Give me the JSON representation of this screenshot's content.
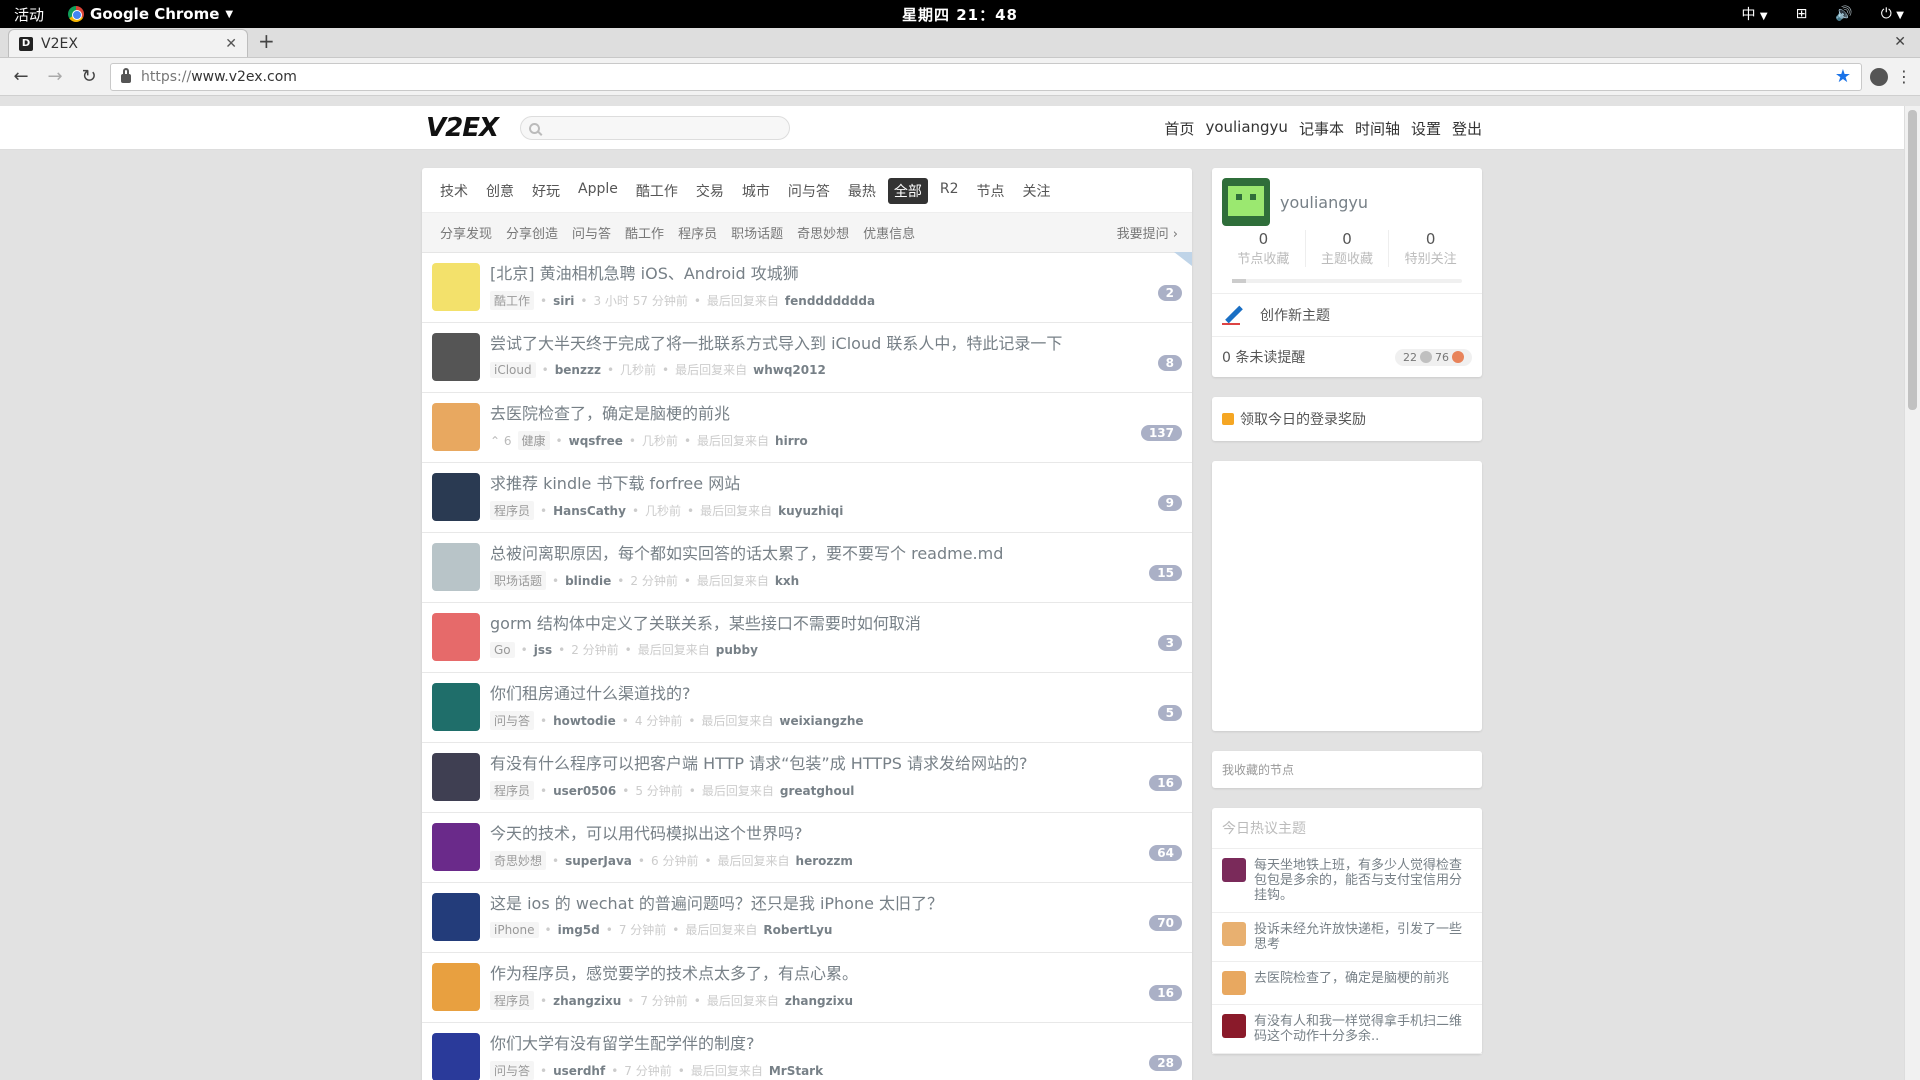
{
  "gnome": {
    "activities": "活动",
    "app": "Google Chrome",
    "clock": "星期四 21：48",
    "ime": "中"
  },
  "browser": {
    "tab_title": "V2EX",
    "url_scheme": "https://",
    "url_host": "www.v2ex.com"
  },
  "site": {
    "logo": "V2EX",
    "search_placeholder": "",
    "nav": [
      "首页",
      "youliangyu",
      "记事本",
      "时间轴",
      "设置",
      "登出"
    ],
    "tabs": [
      "技术",
      "创意",
      "好玩",
      "Apple",
      "酷工作",
      "交易",
      "城市",
      "问与答",
      "最热",
      "全部",
      "R2",
      "节点",
      "关注"
    ],
    "active_tab": "全部",
    "subtabs": [
      "分享发现",
      "分享创造",
      "问与答",
      "酷工作",
      "程序员",
      "职场话题",
      "奇思妙想",
      "优惠信息"
    ],
    "ask": "我要提问 ›",
    "last_reply_prefix": "最后回复来自"
  },
  "topics": [
    {
      "title": "[北京] 黄油相机急聘 iOS、Android 攻城狮",
      "node": "酷工作",
      "author": "siri",
      "time": "3 小时 57 分钟前",
      "last": "fenddddddda",
      "count": "2",
      "votes": ""
    },
    {
      "title": "尝试了大半天终于完成了将一批联系方式导入到 iCloud 联系人中，特此记录一下",
      "node": "iCloud",
      "author": "benzzz",
      "time": "几秒前",
      "last": "whwq2012",
      "count": "8",
      "votes": ""
    },
    {
      "title": "去医院检查了，确定是脑梗的前兆",
      "node": "健康",
      "author": "wqsfree",
      "time": "几秒前",
      "last": "hirro",
      "count": "137",
      "votes": "6"
    },
    {
      "title": "求推荐 kindle 书下载 forfree 网站",
      "node": "程序员",
      "author": "HansCathy",
      "time": "几秒前",
      "last": "kuyuzhiqi",
      "count": "9",
      "votes": ""
    },
    {
      "title": "总被问离职原因，每个都如实回答的话太累了，要不要写个 readme.md",
      "node": "职场话题",
      "author": "blindie",
      "time": "2 分钟前",
      "last": "kxh",
      "count": "15",
      "votes": ""
    },
    {
      "title": "gorm 结构体中定义了关联关系，某些接口不需要时如何取消",
      "node": "Go",
      "author": "jss",
      "time": "2 分钟前",
      "last": "pubby",
      "count": "3",
      "votes": ""
    },
    {
      "title": "你们租房通过什么渠道找的?",
      "node": "问与答",
      "author": "howtodie",
      "time": "4 分钟前",
      "last": "weixiangzhe",
      "count": "5",
      "votes": ""
    },
    {
      "title": "有没有什么程序可以把客户端 HTTP 请求“包装”成 HTTPS 请求发给网站的?",
      "node": "程序员",
      "author": "user0506",
      "time": "5 分钟前",
      "last": "greatghoul",
      "count": "16",
      "votes": ""
    },
    {
      "title": "今天的技术，可以用代码模拟出这个世界吗?",
      "node": "奇思妙想",
      "author": "superJava",
      "time": "6 分钟前",
      "last": "herozzm",
      "count": "64",
      "votes": ""
    },
    {
      "title": "这是 ios 的 wechat 的普遍问题吗？还只是我 iPhone 太旧了？",
      "node": "iPhone",
      "author": "img5d",
      "time": "7 分钟前",
      "last": "RobertLyu",
      "count": "70",
      "votes": ""
    },
    {
      "title": "作为程序员，感觉要学的技术点太多了，有点心累。",
      "node": "程序员",
      "author": "zhangzixu",
      "time": "7 分钟前",
      "last": "zhangzixu",
      "count": "16",
      "votes": ""
    },
    {
      "title": "你们大学有没有留学生配学伴的制度?",
      "node": "问与答",
      "author": "userdhf",
      "time": "7 分钟前",
      "last": "MrStark",
      "count": "28",
      "votes": ""
    }
  ],
  "avatar_colors": [
    "#f3e16b",
    "#555555",
    "#e8a860",
    "#2a3a52",
    "#b8c4c8",
    "#e66a6a",
    "#1f6e6a",
    "#3f3f52",
    "#6a2a8a",
    "#233c7a",
    "#e8a040",
    "#2a3a9a"
  ],
  "sidebar": {
    "username": "youliangyu",
    "stats": [
      {
        "num": "0",
        "label": "节点收藏"
      },
      {
        "num": "0",
        "label": "主题收藏"
      },
      {
        "num": "0",
        "label": "特别关注"
      }
    ],
    "progress": 0.06,
    "create": "创作新主题",
    "unread": "0 条未读提醒",
    "silver": "22",
    "bronze": "76",
    "reward": "领取今日的登录奖励",
    "fav_nodes": "我收藏的节点",
    "hot_title": "今日热议主题",
    "hot": [
      {
        "text": "每天坐地铁上班，有多少人觉得检查包包是多余的，能否与支付宝信用分挂钩。",
        "color": "#7a2a5a"
      },
      {
        "text": "投诉未经允许放快递柜，引发了一些思考",
        "color": "#e8b070"
      },
      {
        "text": "去医院检查了，确定是脑梗的前兆",
        "color": "#e8a860"
      },
      {
        "text": "有没有人和我一样觉得拿手机扫二维码这个动作十分多余..",
        "color": "#8a1a2a"
      }
    ]
  }
}
